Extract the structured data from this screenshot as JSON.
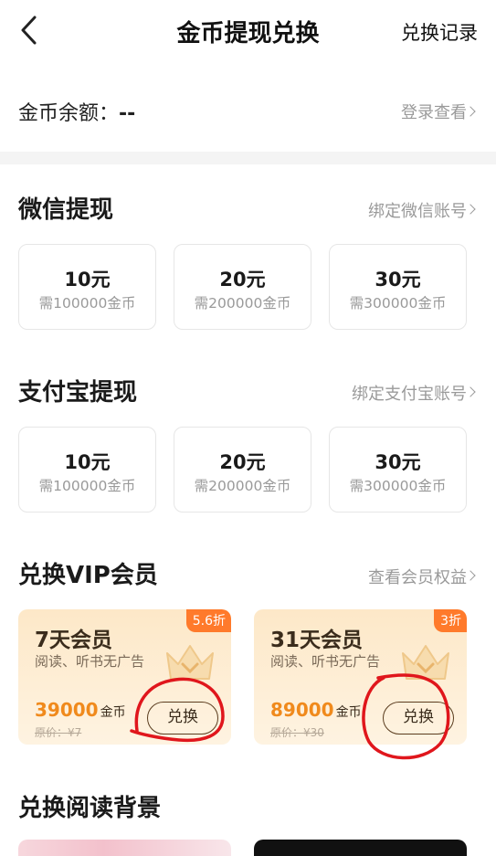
{
  "header": {
    "title": "金币提现兑换",
    "right_link": "兑换记录"
  },
  "balance": {
    "label": "金币余额：",
    "value": "--",
    "link": "登录查看"
  },
  "wechat": {
    "title": "微信提现",
    "link": "绑定微信账号",
    "options": [
      {
        "amount": "10元",
        "cost": "需100000金币"
      },
      {
        "amount": "20元",
        "cost": "需200000金币"
      },
      {
        "amount": "30元",
        "cost": "需300000金币"
      }
    ]
  },
  "alipay": {
    "title": "支付宝提现",
    "link": "绑定支付宝账号",
    "options": [
      {
        "amount": "10元",
        "cost": "需100000金币"
      },
      {
        "amount": "20元",
        "cost": "需200000金币"
      },
      {
        "amount": "30元",
        "cost": "需300000金币"
      }
    ]
  },
  "vip": {
    "title": "兑换VIP会员",
    "link": "查看会员权益",
    "cards": [
      {
        "name": "7天会员",
        "desc": "阅读、听书无广告",
        "badge": "5.6折",
        "price": "39000",
        "unit": "金币",
        "original": "原价：¥7",
        "button": "兑换"
      },
      {
        "name": "31天会员",
        "desc": "阅读、听书无广告",
        "badge": "3折",
        "price": "89000",
        "unit": "金币",
        "original": "原价：¥30",
        "button": "兑换"
      }
    ]
  },
  "background": {
    "title": "兑换阅读背景"
  },
  "colors": {
    "accent": "#f08a1c",
    "badge": "#ff7a2b",
    "annotation": "#e0161c"
  }
}
